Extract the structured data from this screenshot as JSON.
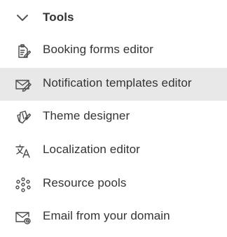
{
  "section": {
    "title": "Tools",
    "expanded": true,
    "icon": "chevron-down-icon"
  },
  "items": [
    {
      "label": "Booking forms editor",
      "icon": "form-edit-icon",
      "active": false
    },
    {
      "label": "Notification templates editor",
      "icon": "envelope-edit-icon",
      "active": true
    },
    {
      "label": "Theme designer",
      "icon": "paint-palette-icon",
      "active": false
    },
    {
      "label": "Localization editor",
      "icon": "translate-icon",
      "active": false
    },
    {
      "label": "Resource pools",
      "icon": "resource-pool-icon",
      "active": false
    },
    {
      "label": "Email from your domain",
      "icon": "email-at-icon",
      "active": false
    }
  ],
  "colors": {
    "active_background": "#e8e8e8",
    "text": "#333333",
    "icon": "#4a4a4a"
  }
}
